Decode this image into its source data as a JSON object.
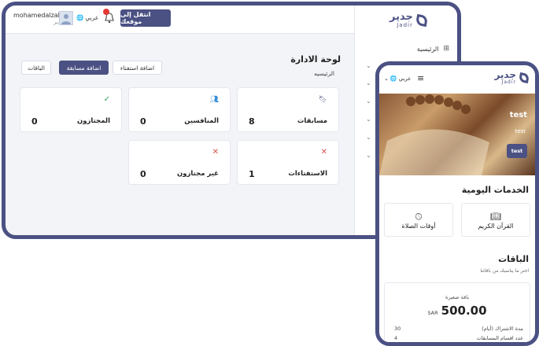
{
  "brand": {
    "name_ar": "جدير",
    "name_en": "Jadir"
  },
  "desktop": {
    "topbar": {
      "user_name": "mohamedalzaki",
      "user_role": "مدير",
      "language": "عربي",
      "visit_site_label": "انتقل إلى موقعك"
    },
    "header": {
      "title": "لوحة الادارة",
      "breadcrumb": "الرئيسيه"
    },
    "actions": {
      "packages_label": "الباقات",
      "add_competition_label": "اضافة مسابقة",
      "add_poll_label": "اضافة استفتاء"
    },
    "sidebar": {
      "home_label": "الرئيسية"
    },
    "stats": [
      {
        "label": "مسابقات",
        "value": "8",
        "icon": "bookmark-icon"
      },
      {
        "label": "المنافسين",
        "value": "0",
        "icon": "users-icon"
      },
      {
        "label": "المجتازون",
        "value": "0",
        "icon": "check-circle-icon"
      },
      {
        "label": "الاستفتاءات",
        "value": "1",
        "icon": "close-icon"
      },
      {
        "label": "غير مجتازون",
        "value": "0",
        "icon": "close-icon"
      }
    ]
  },
  "mobile": {
    "header": {
      "language": "عربي"
    },
    "hero": {
      "title": "test",
      "subtitle": "test",
      "button_label": "test"
    },
    "daily_services": {
      "title": "الخدمات اليومية",
      "items": [
        {
          "label": "القرآن الكريم",
          "icon": "book-icon"
        },
        {
          "label": "أوقات الصلاة",
          "icon": "clock-icon"
        }
      ]
    },
    "packages": {
      "title": "الباقات",
      "subtitle": "اختر ما يناسبك من باقاتنا",
      "card": {
        "name": "باقة صغيرة",
        "price": "500.00",
        "currency": "SAR",
        "rows": [
          {
            "label": "مدة الاشتراك (أيام)",
            "value": "30"
          },
          {
            "label": "عدد اقسام المسابقات",
            "value": "4"
          }
        ]
      }
    }
  },
  "colors": {
    "primary": "#4b5183",
    "success": "#2e9e5b",
    "danger": "#d9534f",
    "notify": "#e53935"
  }
}
